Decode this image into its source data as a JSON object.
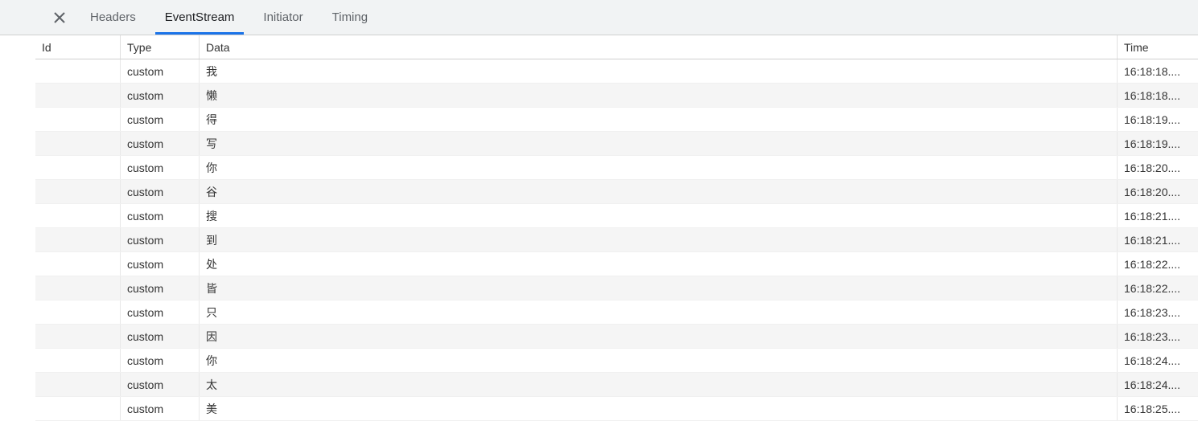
{
  "tabs": {
    "headers": "Headers",
    "eventstream": "EventStream",
    "initiator": "Initiator",
    "timing": "Timing"
  },
  "table": {
    "headers": {
      "id": "Id",
      "type": "Type",
      "data": "Data",
      "time": "Time"
    },
    "rows": [
      {
        "id": "",
        "type": "custom",
        "data": "我",
        "time": "16:18:18...."
      },
      {
        "id": "",
        "type": "custom",
        "data": "懒",
        "time": "16:18:18...."
      },
      {
        "id": "",
        "type": "custom",
        "data": "得",
        "time": "16:18:19...."
      },
      {
        "id": "",
        "type": "custom",
        "data": "写",
        "time": "16:18:19...."
      },
      {
        "id": "",
        "type": "custom",
        "data": "你",
        "time": "16:18:20...."
      },
      {
        "id": "",
        "type": "custom",
        "data": "谷",
        "time": "16:18:20...."
      },
      {
        "id": "",
        "type": "custom",
        "data": "搜",
        "time": "16:18:21...."
      },
      {
        "id": "",
        "type": "custom",
        "data": "到",
        "time": "16:18:21...."
      },
      {
        "id": "",
        "type": "custom",
        "data": "处",
        "time": "16:18:22...."
      },
      {
        "id": "",
        "type": "custom",
        "data": "皆",
        "time": "16:18:22...."
      },
      {
        "id": "",
        "type": "custom",
        "data": "只",
        "time": "16:18:23...."
      },
      {
        "id": "",
        "type": "custom",
        "data": "因",
        "time": "16:18:23...."
      },
      {
        "id": "",
        "type": "custom",
        "data": "你",
        "time": "16:18:24...."
      },
      {
        "id": "",
        "type": "custom",
        "data": "太",
        "time": "16:18:24...."
      },
      {
        "id": "",
        "type": "custom",
        "data": "美",
        "time": "16:18:25...."
      }
    ]
  }
}
